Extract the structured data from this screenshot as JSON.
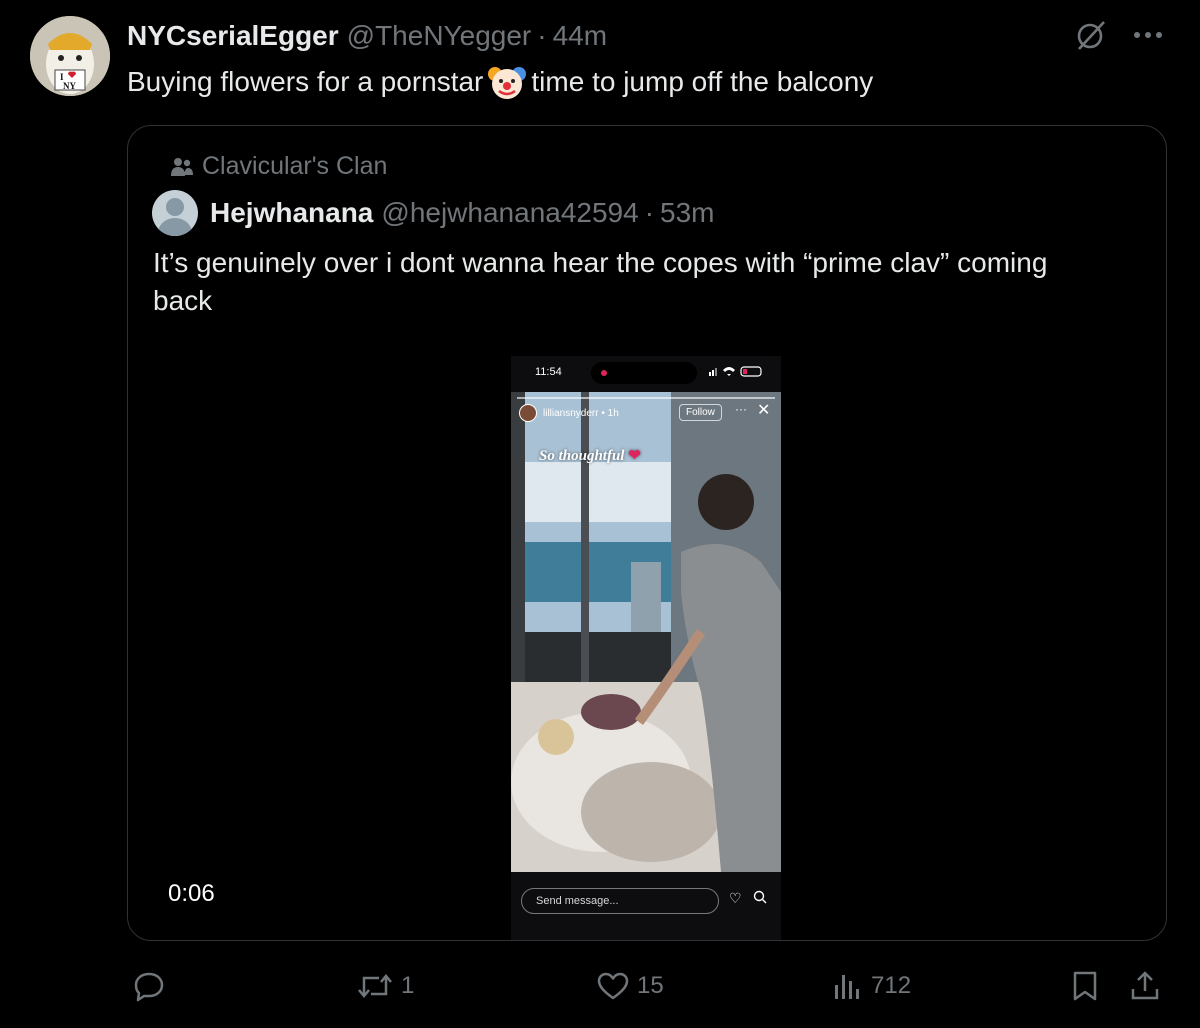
{
  "tweet": {
    "display_name": "NYCserialEgger",
    "handle": "@TheNYegger",
    "separator": "·",
    "time": "44m",
    "text_before": "Buying flowers for a pornstar",
    "text_after": "time to jump off the balcony",
    "avatar_text_top": "I",
    "avatar_text_bottom": "NY"
  },
  "quote": {
    "community": "Clavicular's Clan",
    "display_name": "Hejwhanana",
    "handle": "@hejwhanana42594",
    "separator": "·",
    "time": "53m",
    "text": "It’s genuinely over i dont wanna hear the copes with “prime clav” coming back",
    "video": {
      "duration": "0:06",
      "phone_time": "11:54",
      "story_user": "lilliansnyderr • 1h",
      "follow_label": "Follow",
      "more_label": "···",
      "close_label": "✕",
      "caption": "So thoughtful",
      "message_placeholder": "Send message..."
    }
  },
  "actions": {
    "reply_count": "",
    "retweet_count": "1",
    "like_count": "15",
    "view_count": "712"
  },
  "colors": {
    "background": "#000000",
    "text_primary": "#e7e9ea",
    "text_secondary": "#71767b",
    "border": "#2f3336"
  }
}
